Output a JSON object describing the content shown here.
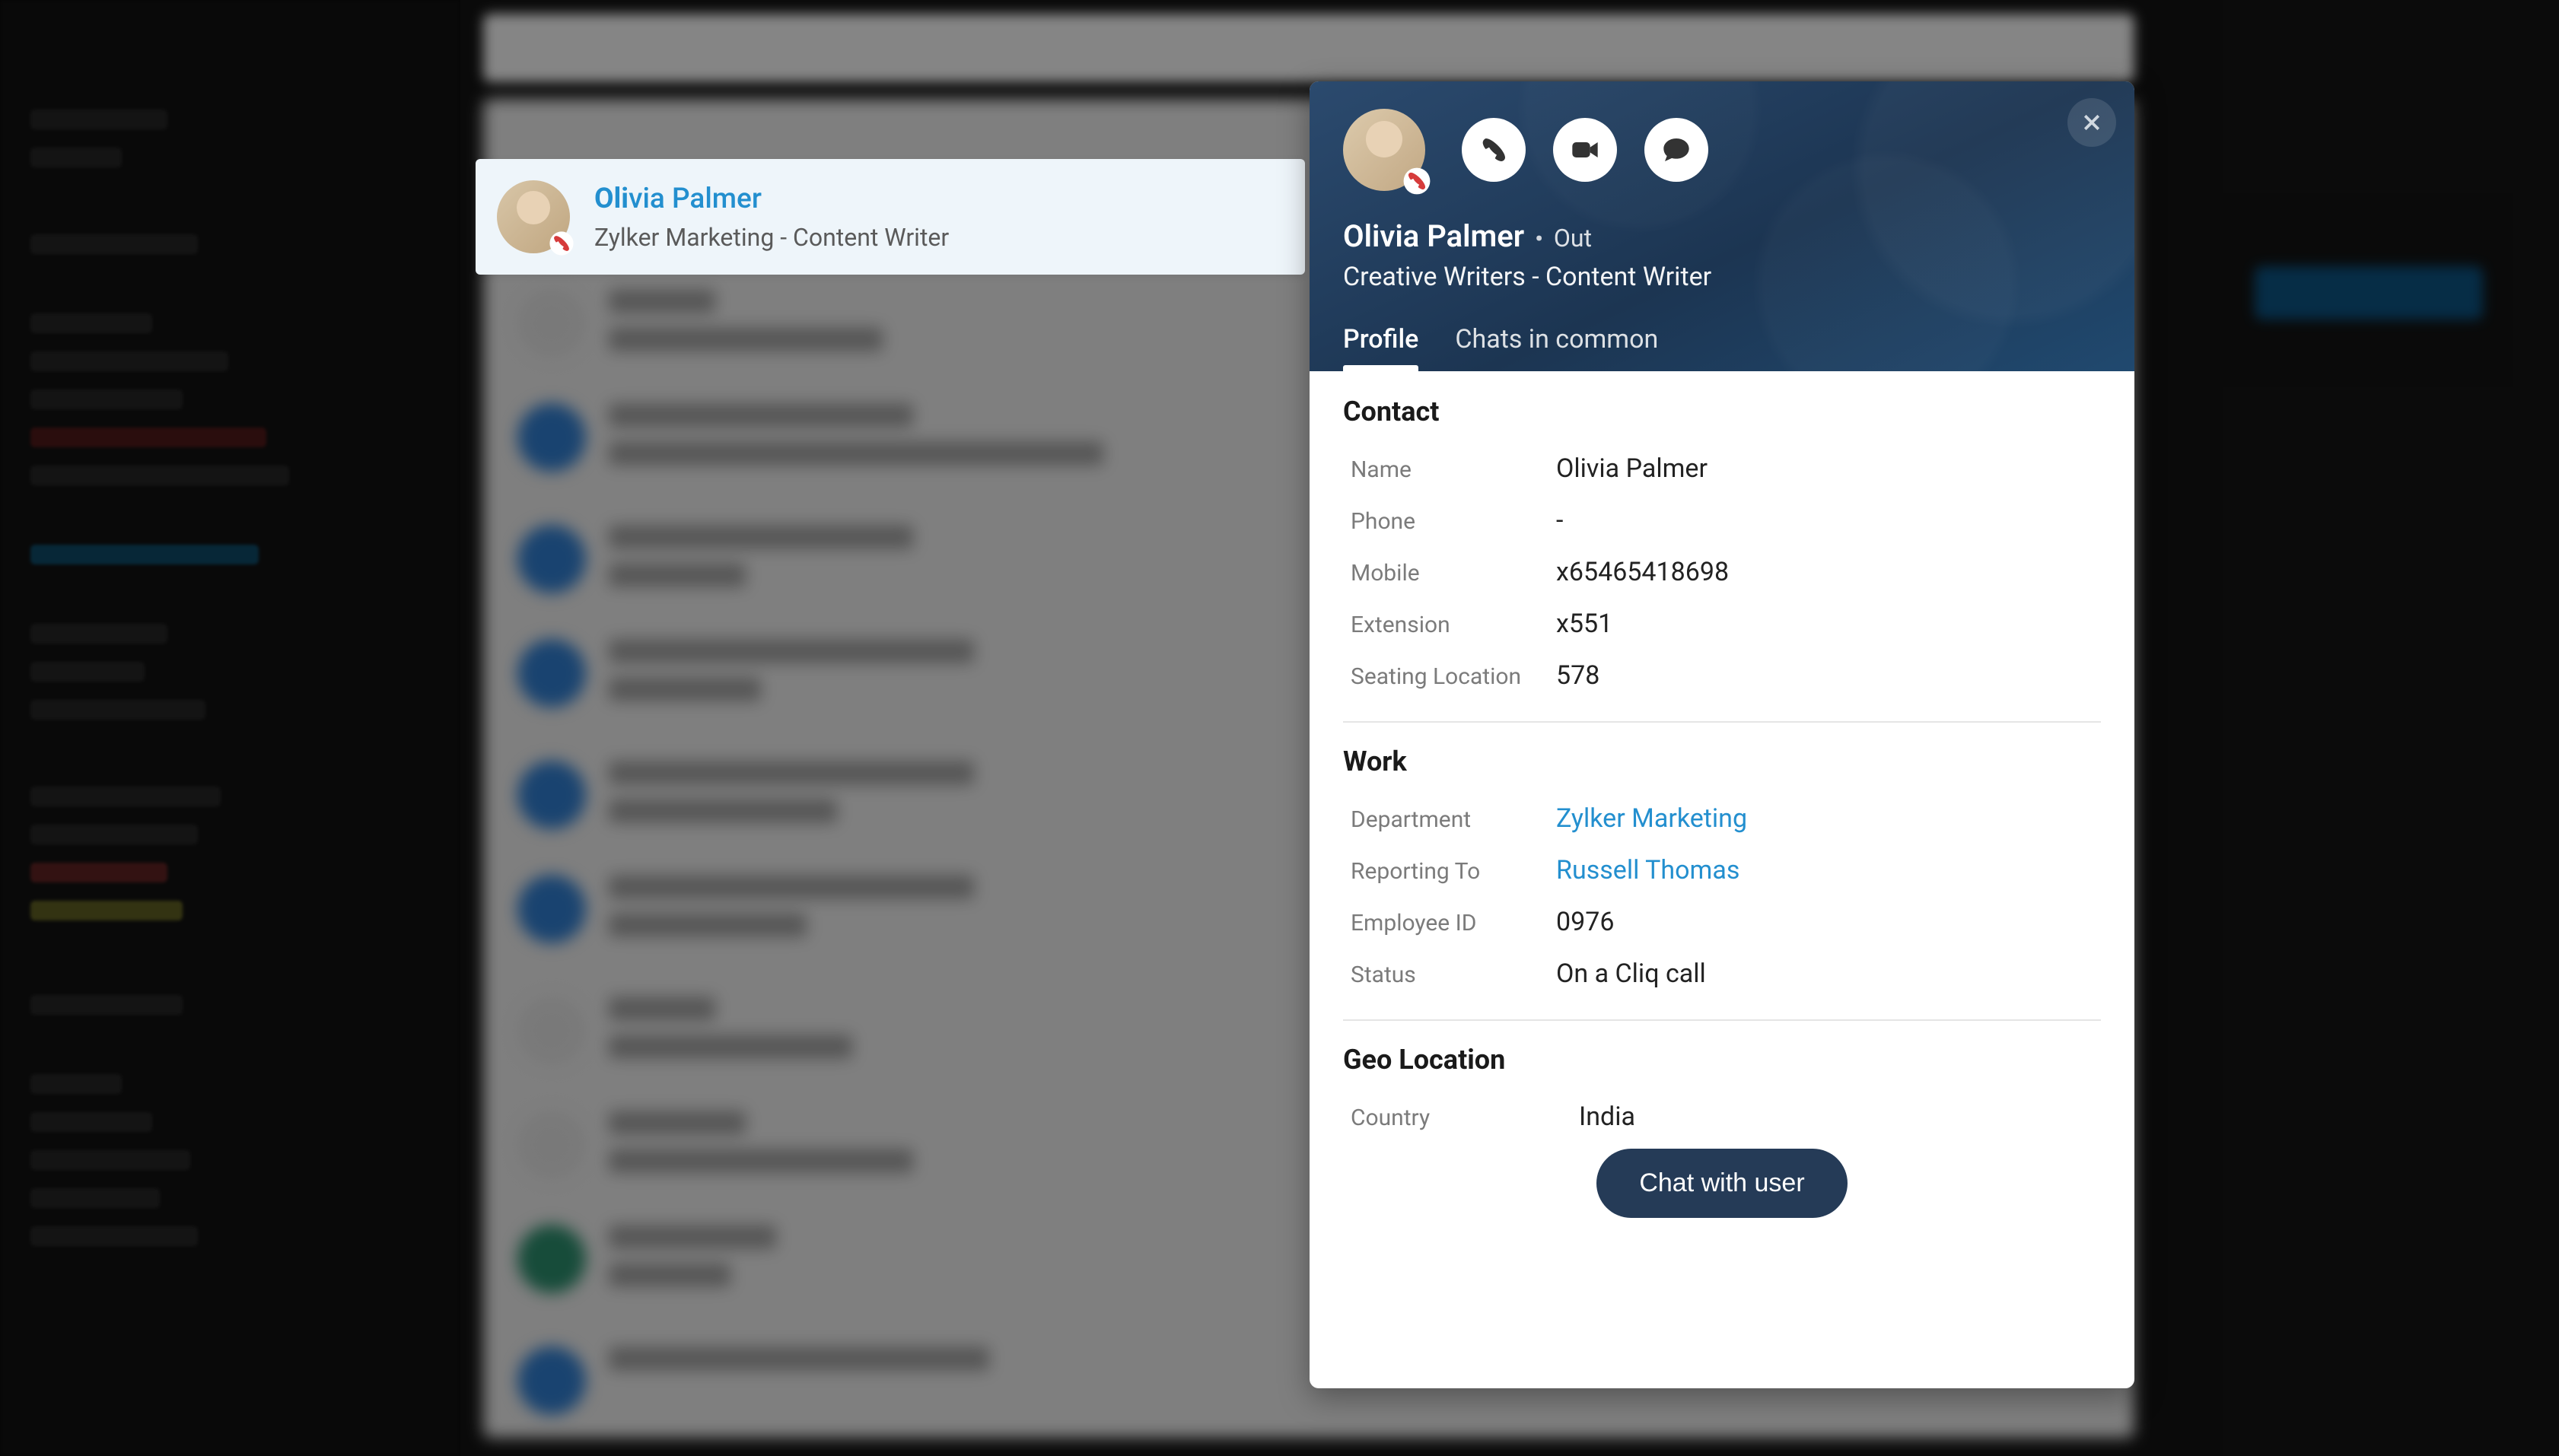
{
  "search_result": {
    "name_highlight": "Oli",
    "name_rest": "via  Palmer",
    "subtitle": "Zylker Marketing - Content Writer"
  },
  "profile": {
    "name": "Olivia  Palmer",
    "status": "Out",
    "subtitle": "Creative Writers  -  Content Writer",
    "tabs": {
      "profile": "Profile",
      "chats": "Chats in common"
    },
    "sections": {
      "contact": {
        "title": "Contact",
        "name_label": "Name",
        "name_value": "Olivia  Palmer",
        "phone_label": "Phone",
        "phone_value": "-",
        "mobile_label": "Mobile",
        "mobile_value": "x65465418698",
        "extension_label": "Extension",
        "extension_value": "x551",
        "seating_label": "Seating Location",
        "seating_value": "578"
      },
      "work": {
        "title": "Work",
        "department_label": "Department",
        "department_value": "Zylker Marketing",
        "reporting_label": "Reporting To",
        "reporting_value": "Russell Thomas",
        "employee_id_label": "Employee ID",
        "employee_id_value": "0976",
        "status_label": "Status",
        "status_value": "On a Cliq call"
      },
      "geo": {
        "title": "Geo Location",
        "country_label": "Country",
        "country_value": "India"
      }
    },
    "chat_button": "Chat with user"
  }
}
